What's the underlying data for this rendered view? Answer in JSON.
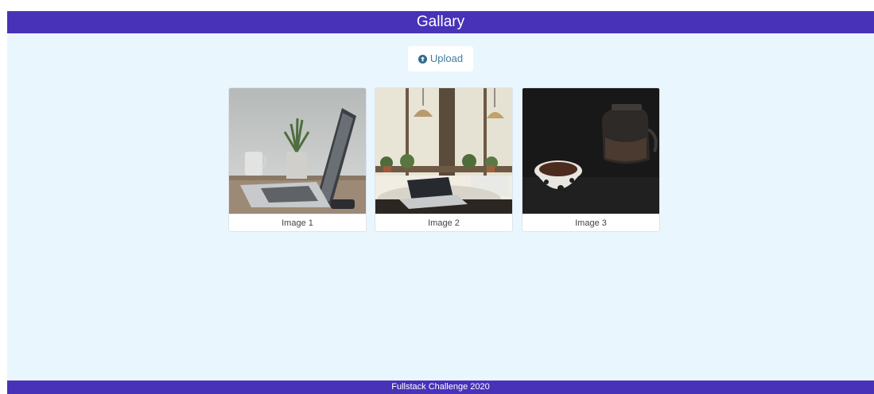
{
  "header": {
    "title": "Gallary"
  },
  "toolbar": {
    "upload_label": "Upload",
    "upload_icon": "upload-circle-icon"
  },
  "gallery": {
    "items": [
      {
        "caption": "Image 1"
      },
      {
        "caption": "Image 2"
      },
      {
        "caption": "Image 3"
      }
    ]
  },
  "footer": {
    "text": "Fullstack Challenge 2020"
  },
  "colors": {
    "header_bg": "#4832b8",
    "page_bg": "#eaf6fe",
    "accent_text": "#3d7ea0"
  }
}
